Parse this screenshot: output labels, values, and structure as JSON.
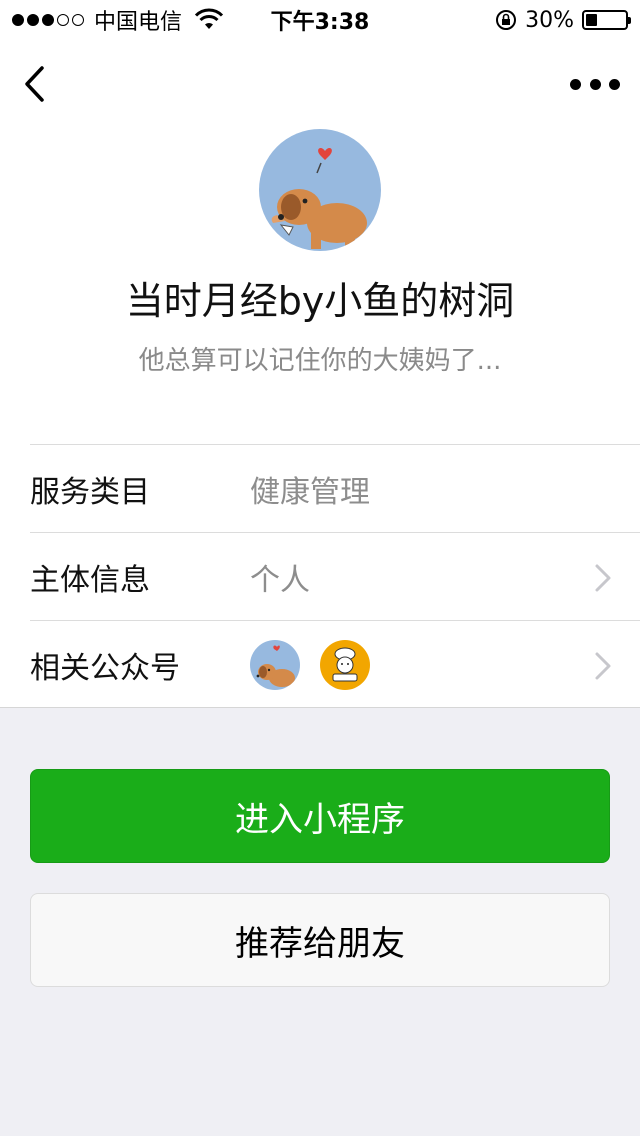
{
  "status_bar": {
    "carrier": "中国电信",
    "time": "下午3:38",
    "battery_percent_label": "30%",
    "battery_level": 0.3
  },
  "nav": {
    "back_icon": "chevron-left-icon",
    "more_icon": "more-dots-icon"
  },
  "profile": {
    "name": "当时月经by小鱼的树洞",
    "description": "他总算可以记住你的大姨妈了..."
  },
  "info_rows": [
    {
      "label": "服务类目",
      "value": "健康管理"
    },
    {
      "label": "主体信息",
      "value": "个人"
    },
    {
      "label": "相关公众号",
      "value": ""
    }
  ],
  "buttons": {
    "enter": "进入小程序",
    "recommend": "推荐给朋友"
  },
  "colors": {
    "primary_green": "#1aad19",
    "page_gray": "#efeff4",
    "secondary_text": "#8a8a8a"
  }
}
